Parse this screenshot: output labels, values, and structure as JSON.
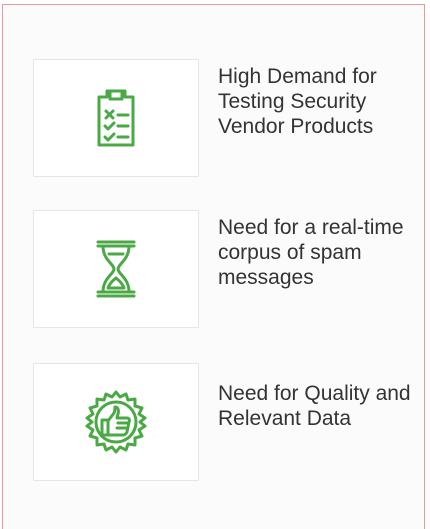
{
  "colors": {
    "accent": "#4aa845",
    "panel_border": "#e79a9a",
    "text": "#333333"
  },
  "features": [
    {
      "icon": "checklist-icon",
      "label": "High Demand for Testing Security Vendor Products"
    },
    {
      "icon": "hourglass-icon",
      "label": "Need for a real-time corpus of spam messages"
    },
    {
      "icon": "quality-badge-thumbs-up-icon",
      "label": "Need for Quality and Relevant Data"
    }
  ]
}
